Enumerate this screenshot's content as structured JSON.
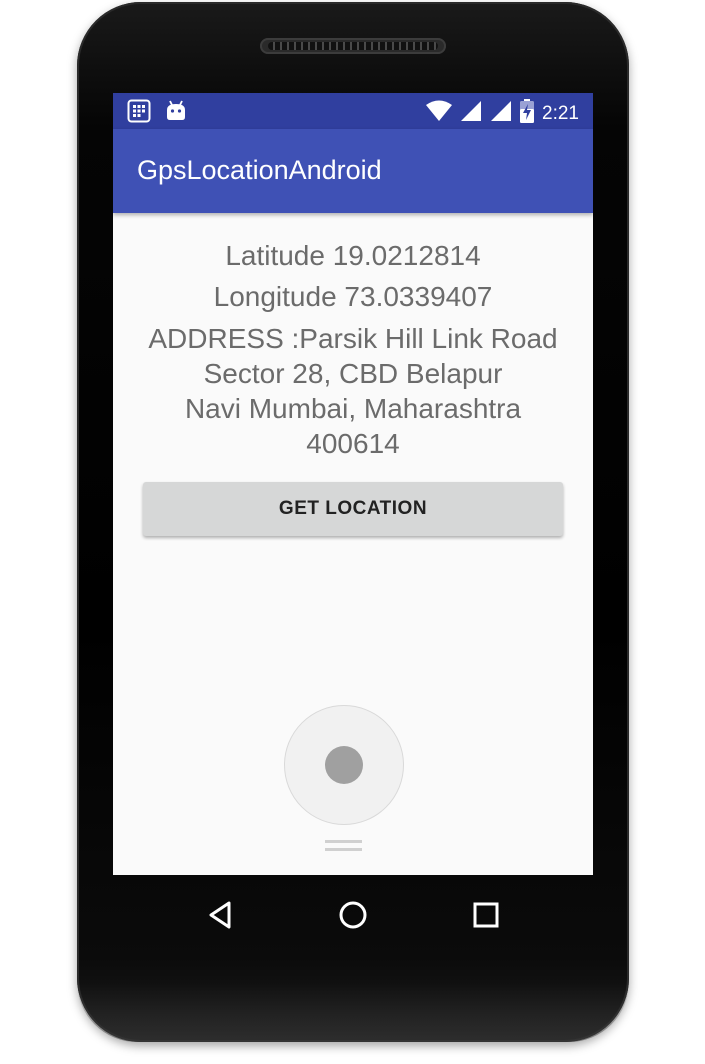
{
  "status_bar": {
    "time": "2:21",
    "icons": [
      "apps-icon",
      "android-icon",
      "wifi-icon",
      "signal-icon",
      "signal-icon",
      "battery-icon"
    ]
  },
  "app_bar": {
    "title": "GpsLocationAndroid"
  },
  "location": {
    "latitude_text": "Latitude 19.0212814",
    "longitude_text": "Longitude 73.0339407",
    "address_lines": [
      "ADDRESS :Parsik Hill Link Road",
      "Sector 28, CBD Belapur",
      "Navi Mumbai, Maharashtra",
      "400614"
    ]
  },
  "actions": {
    "get_location_label": "GET LOCATION"
  },
  "nav_bar": {
    "buttons": [
      "back-icon",
      "home-icon",
      "recents-icon"
    ]
  },
  "colors": {
    "status_bar": "#303f9f",
    "app_bar": "#3f51b5",
    "screen_background": "#fafafa",
    "button_background": "#d6d7d7",
    "body_text": "#6b6b6b"
  }
}
